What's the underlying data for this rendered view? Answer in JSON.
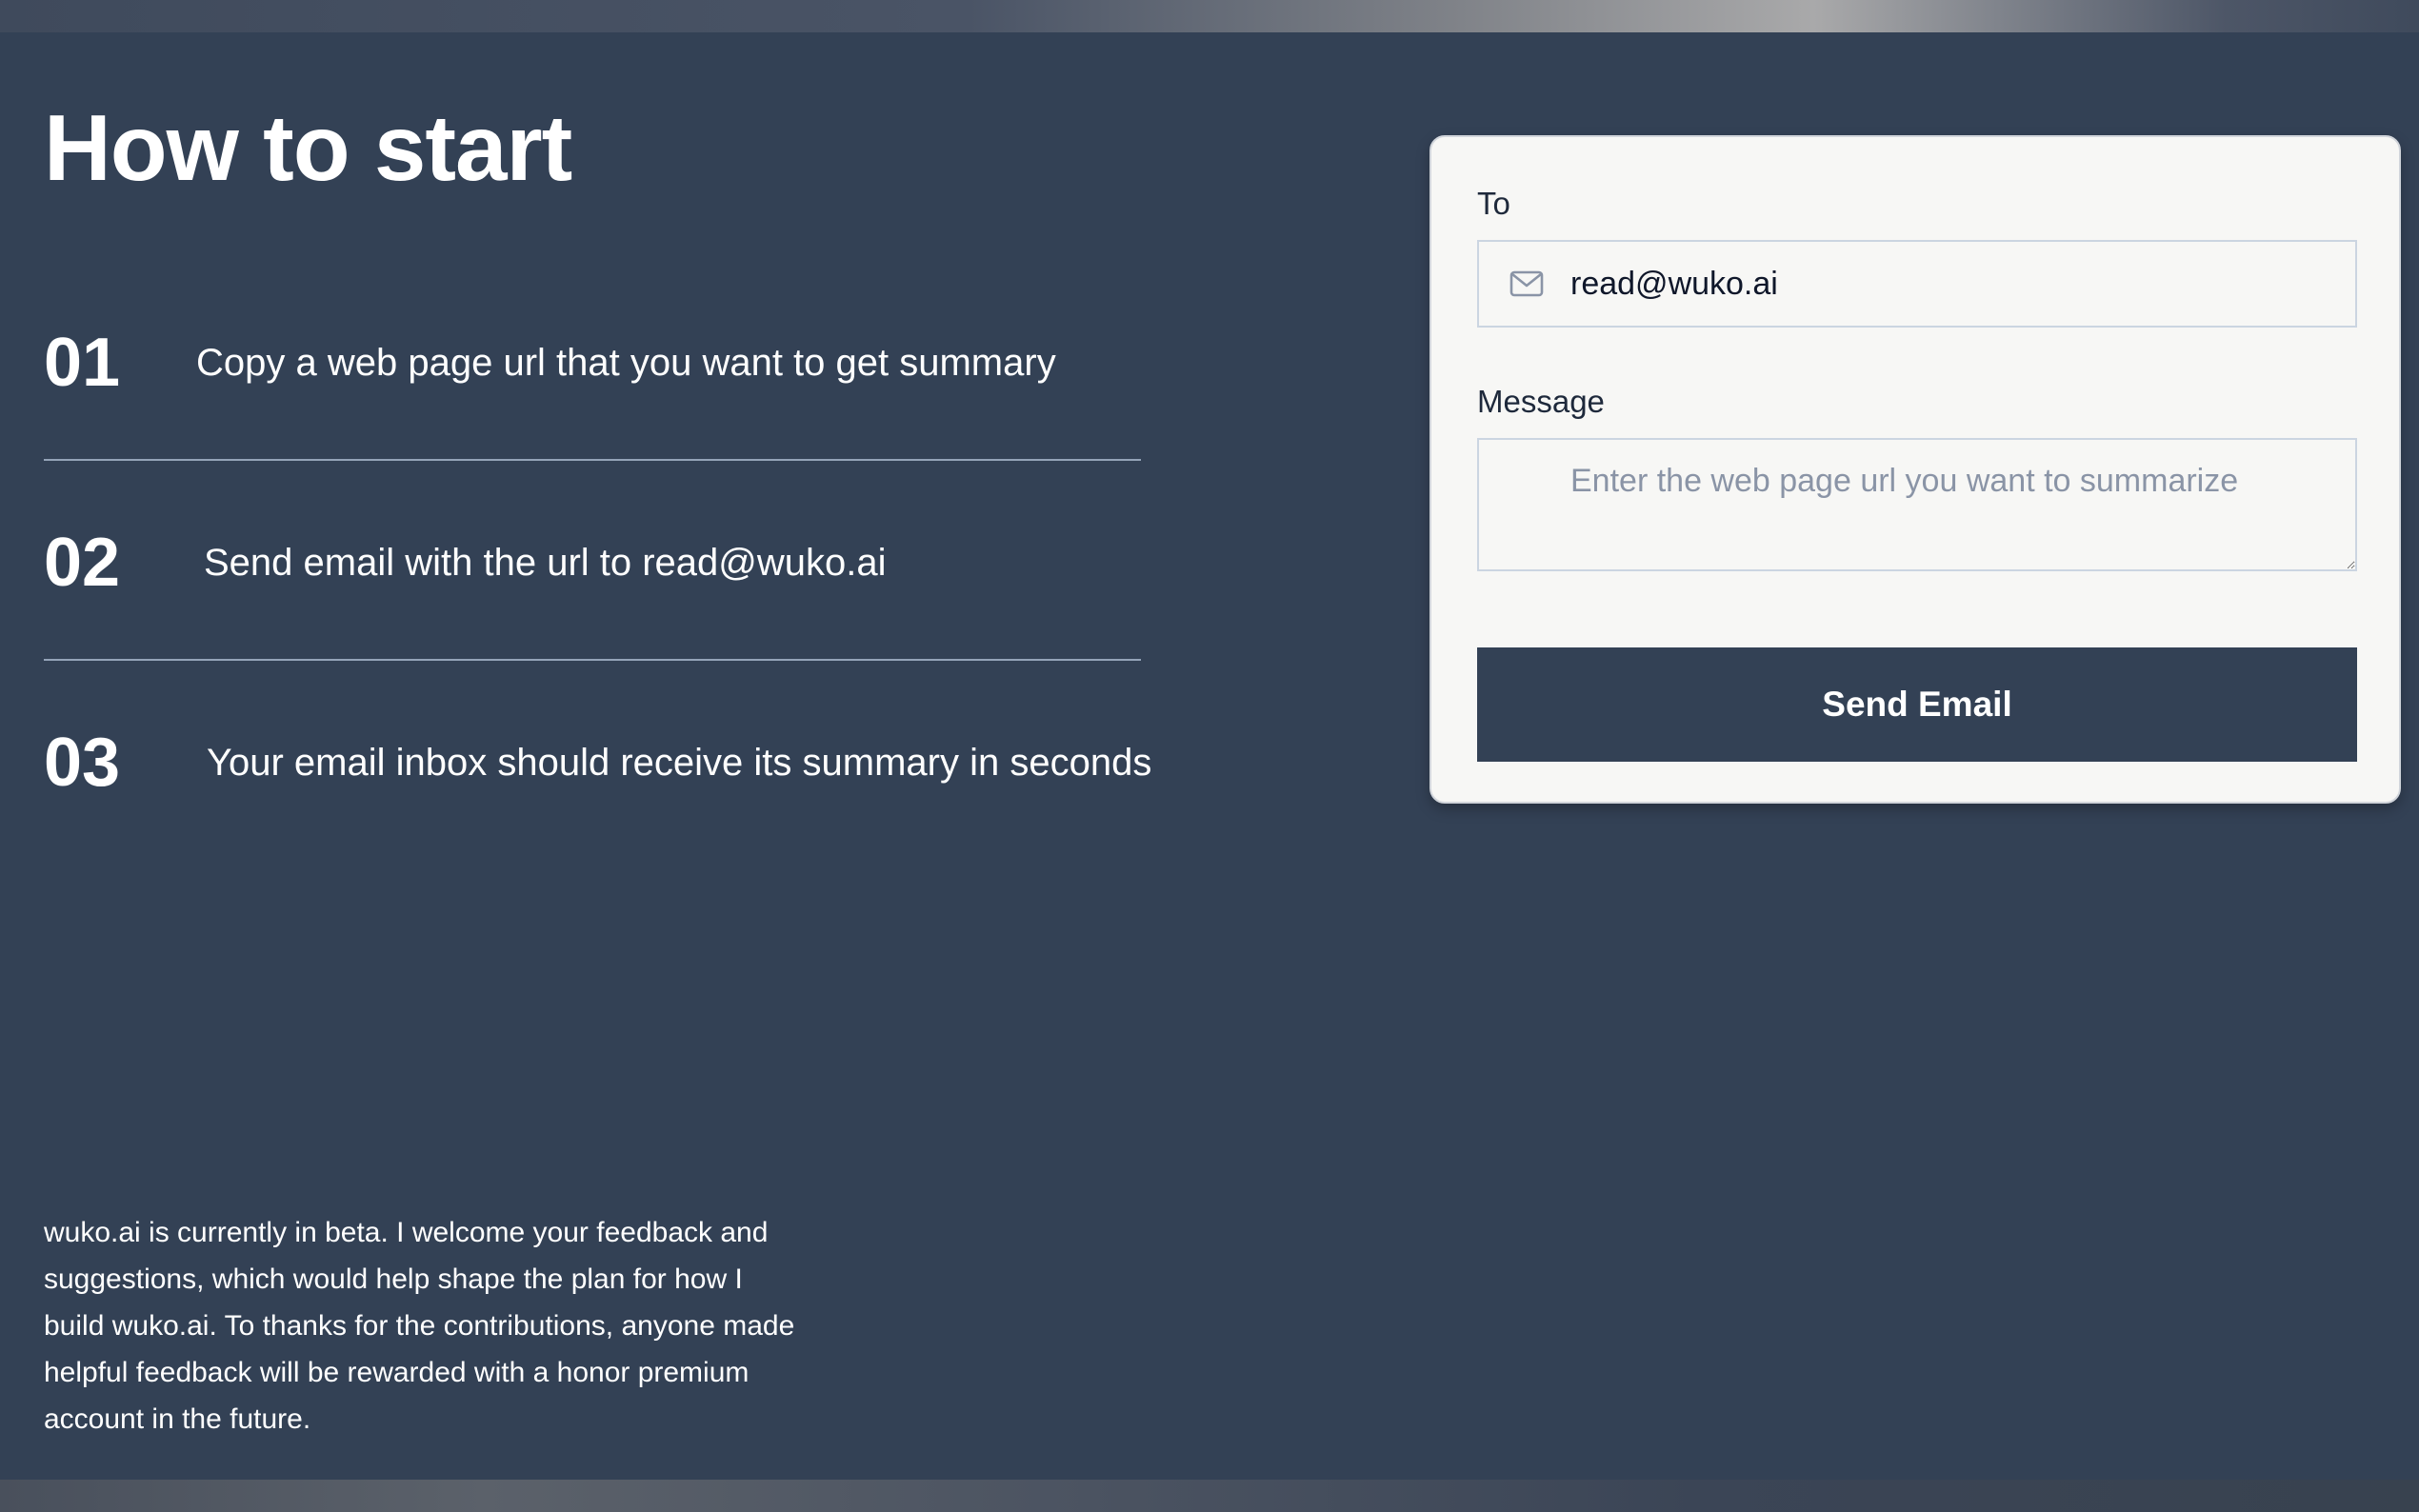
{
  "page": {
    "heading": "How to start"
  },
  "steps": [
    {
      "number": "01",
      "text": "Copy a web page url that you want to get summary"
    },
    {
      "number": "02",
      "text": "Send email with the url to read@wuko.ai"
    },
    {
      "number": "03",
      "text": "Your email inbox should receive its summary in seconds"
    }
  ],
  "beta_note": "wuko.ai is currently in beta. I welcome your feedback and suggestions, which would help shape the plan for how I build wuko.ai. To thanks for the contributions, anyone made helpful feedback will be rewarded with a honor premium account in the future.",
  "form": {
    "to_label": "To",
    "to_value": "read@wuko.ai",
    "to_icon": "mail-icon",
    "message_label": "Message",
    "message_placeholder": "Enter the web page url you want to summarize",
    "message_value": "",
    "submit_label": "Send Email"
  },
  "colors": {
    "background": "#334155",
    "card": "#f7f7f5",
    "button": "#334155",
    "text": "#ffffff",
    "placeholder": "#8a94a6"
  }
}
